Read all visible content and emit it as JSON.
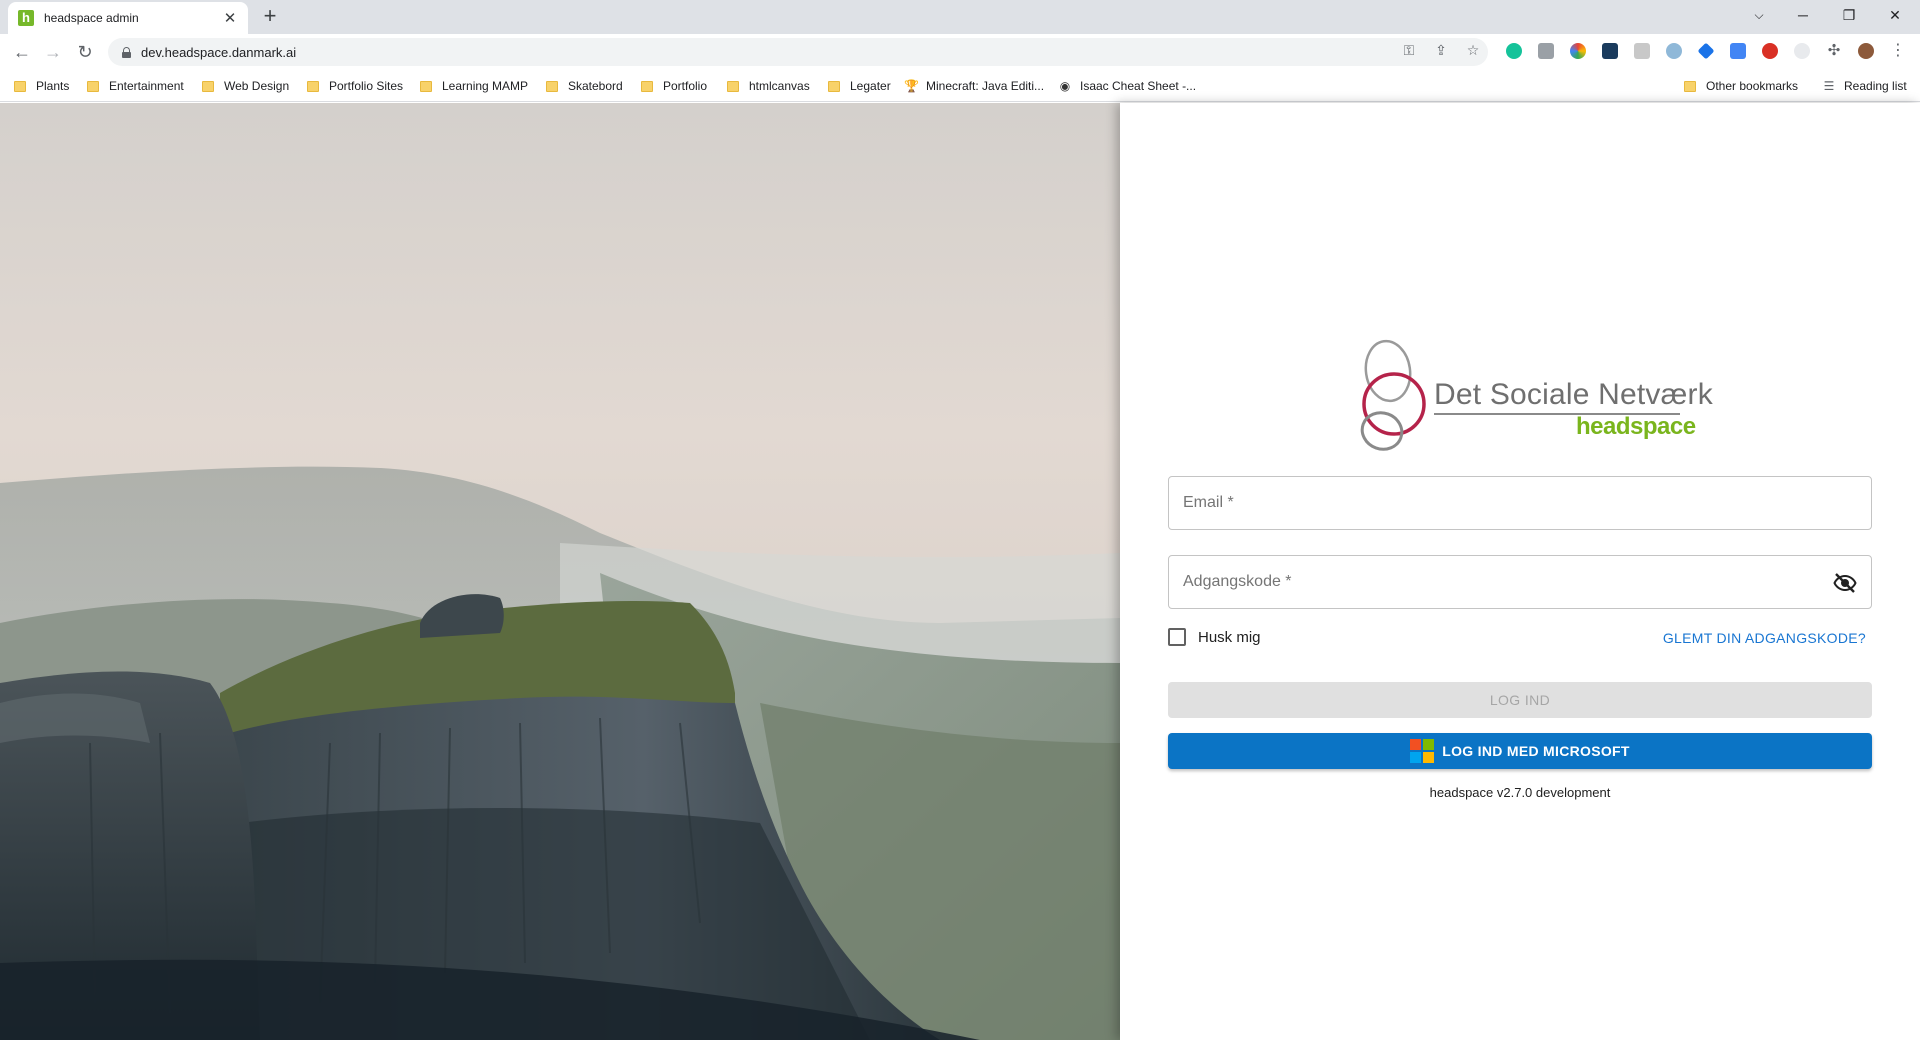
{
  "browser": {
    "tab_title": "headspace admin",
    "tab_favicon": "h",
    "url": "dev.headspace.danmark.ai",
    "bookmarks": [
      {
        "label": "Plants",
        "icon": "folder-icon"
      },
      {
        "label": "Entertainment",
        "icon": "folder-icon"
      },
      {
        "label": "Web Design",
        "icon": "folder-icon"
      },
      {
        "label": "Portfolio Sites",
        "icon": "folder-icon"
      },
      {
        "label": "Learning MAMP",
        "icon": "folder-icon"
      },
      {
        "label": "Skatebord",
        "icon": "folder-icon"
      },
      {
        "label": "Portfolio",
        "icon": "folder-icon"
      },
      {
        "label": "htmlcanvas",
        "icon": "folder-icon"
      },
      {
        "label": "Legater",
        "icon": "folder-icon"
      },
      {
        "label": "Minecraft: Java Editi...",
        "icon": "trophy-icon"
      },
      {
        "label": "Isaac Cheat Sheet -...",
        "icon": "isaac-icon"
      }
    ],
    "other_bookmarks": "Other bookmarks",
    "reading_list": "Reading list"
  },
  "login": {
    "logo_name": "Det Sociale Netværk",
    "logo_sub": "headspace",
    "email_placeholder": "Email *",
    "email_value": "",
    "password_placeholder": "Adgangskode *",
    "password_value": "",
    "remember_label": "Husk mig",
    "remember_checked": false,
    "forgot_label": "GLEMT DIN ADGANGSKODE?",
    "login_label": "LOG IND",
    "microsoft_label": "LOG IND MED MICROSOFT",
    "version": "headspace v2.7.0 development"
  },
  "colors": {
    "brand_green": "#7ab51d",
    "logo_red": "#b5234a",
    "microsoft_blue": "#0b74c5",
    "link_blue": "#1976d2"
  }
}
